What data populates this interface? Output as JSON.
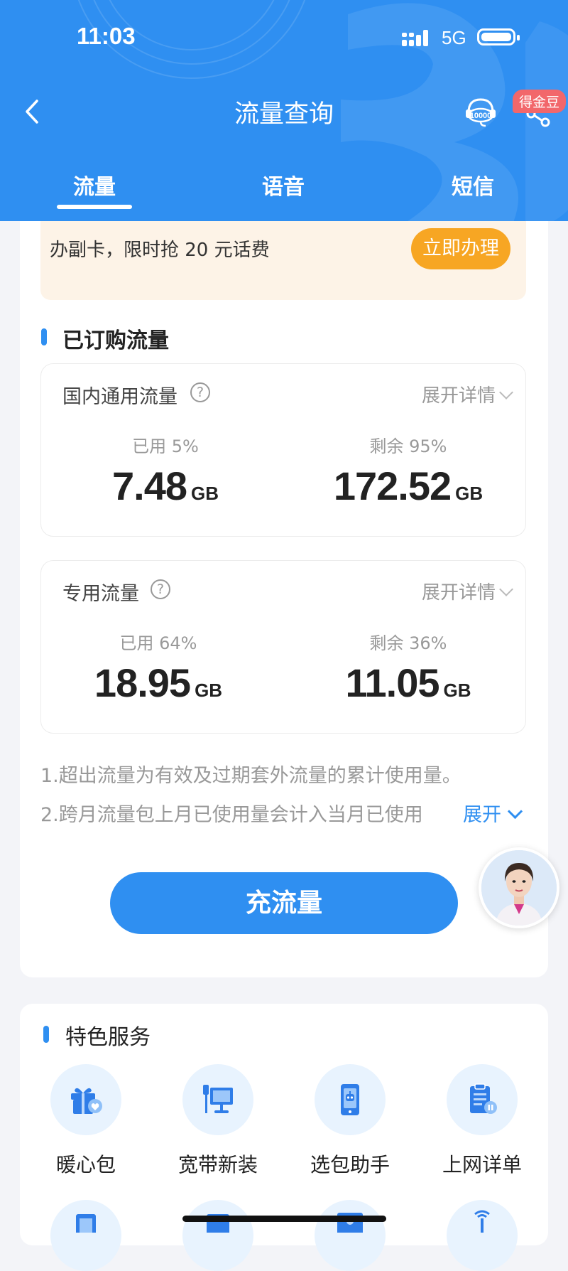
{
  "status_bar": {
    "time": "11:03",
    "network": "5G"
  },
  "nav": {
    "title": "流量查询",
    "coin_badge": "得金豆"
  },
  "tabs": [
    {
      "label": "流量",
      "active": true
    },
    {
      "label": "语音",
      "active": false
    },
    {
      "label": "短信",
      "active": false
    }
  ],
  "promo": {
    "text": "办副卡，限时抢 20 元话费",
    "button": "立即办理"
  },
  "subscribed": {
    "title": "已订购流量",
    "cards": [
      {
        "title": "国内通用流量",
        "expand_label": "展开详情",
        "used_label": "已用 5%",
        "used_value": "7.48",
        "used_unit": "GB",
        "remain_label": "剩余 95%",
        "remain_value": "172.52",
        "remain_unit": "GB"
      },
      {
        "title": "专用流量",
        "expand_label": "展开详情",
        "used_label": "已用 64%",
        "used_value": "18.95",
        "used_unit": "GB",
        "remain_label": "剩余 36%",
        "remain_value": "11.05",
        "remain_unit": "GB"
      }
    ],
    "notes": [
      "1.超出流量为有效及过期套外流量的累计使用量。",
      "2.跨月流量包上月已使用量会计入当月已使用"
    ],
    "expand_link": "展开",
    "recharge_button": "充流量"
  },
  "services": {
    "title": "特色服务",
    "items": [
      {
        "label": "暖心包",
        "icon": "gift-icon"
      },
      {
        "label": "宽带新装",
        "icon": "broadband-icon"
      },
      {
        "label": "选包助手",
        "icon": "robot-phone-icon"
      },
      {
        "label": "上网详单",
        "icon": "bill-list-icon"
      }
    ]
  },
  "colors": {
    "primary": "#2f8ff1",
    "promo_bg": "#fdf3e7",
    "promo_button": "#f7a623",
    "badge": "#f2676b"
  }
}
